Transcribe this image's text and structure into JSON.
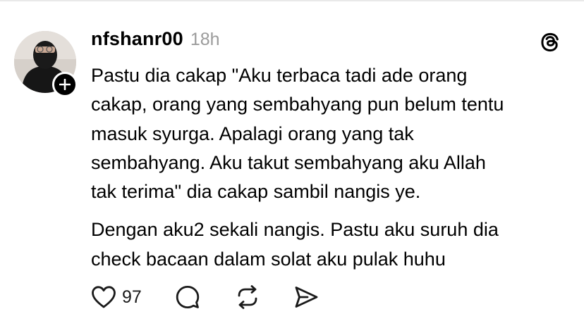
{
  "post": {
    "username": "nfshanr00",
    "time": "18h",
    "paragraphs": [
      "Pastu dia cakap \"Aku terbaca tadi ade orang\ncakap, orang yang sembahyang pun belum tentu\nmasuk syurga. Apalagi orang yang tak\nsembahyang. Aku takut sembahyang aku Allah\ntak terima\" dia cakap sambil nangis ye.",
      "Dengan aku2 sekali nangis. Pastu aku suruh dia\ncheck bacaan dalam solat aku pulak huhu"
    ]
  },
  "actions": {
    "like_count": "97",
    "icons": [
      "heart-icon",
      "comment-icon",
      "repost-icon",
      "share-icon"
    ]
  },
  "icons": {
    "app_logo": "threads-logo-icon",
    "follow": "plus-icon"
  }
}
